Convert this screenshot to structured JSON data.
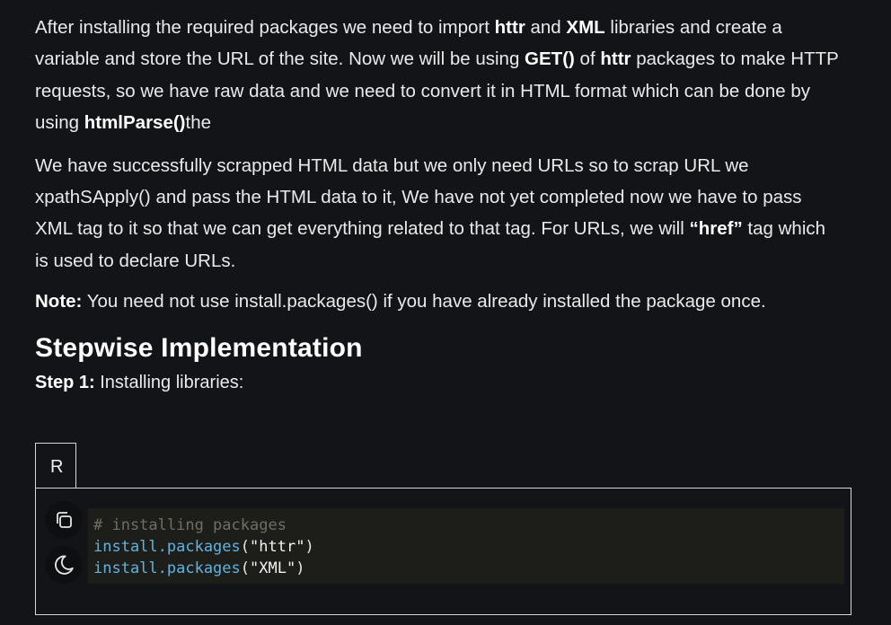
{
  "article": {
    "paragraph1": {
      "t1": "After installing the required packages we need to import ",
      "b1": "httr",
      "t2": " and ",
      "b2": "XML",
      "t3": " libraries and create a variable and store the URL of the site. Now we will be using ",
      "b3": "GET()",
      "t4": " of ",
      "b4": "httr",
      "t5": " packages to make HTTP requests, so we have raw data and we need to convert it in HTML format which can be done by using ",
      "b5": "htmlParse()",
      "t6": "the"
    },
    "paragraph2": {
      "t1": "We have successfully scrapped HTML data but we only need URLs so to scrap URL we xpathSApply() and pass the HTML data to it, We have not yet completed now we have to pass XML tag to it so that we can get everything related to that tag. For URLs, we will ",
      "b1": "“href”",
      "t2": " tag which is used to declare URLs."
    },
    "note": {
      "label": "Note:",
      "text": " You need not use install.packages() if you have already installed the package once."
    },
    "heading": "Stepwise Implementation",
    "step": {
      "label": "Step 1:",
      "text": " Installing libraries:"
    }
  },
  "code_block": {
    "language_tab": "R",
    "lines": {
      "comment": "# installing packages",
      "line2": {
        "fn": "install.packages",
        "open": "(",
        "arg": "\"httr\"",
        "close": ")"
      },
      "line3": {
        "fn": "install.packages",
        "open": "(",
        "arg": "\"XML\"",
        "close": ")"
      }
    },
    "icons": [
      "copy-icon",
      "moon-icon"
    ]
  },
  "colors": {
    "background": "#131417",
    "code_background": "#1d1e1a",
    "function": "#5fb3e0",
    "comment": "#6e6e66"
  }
}
